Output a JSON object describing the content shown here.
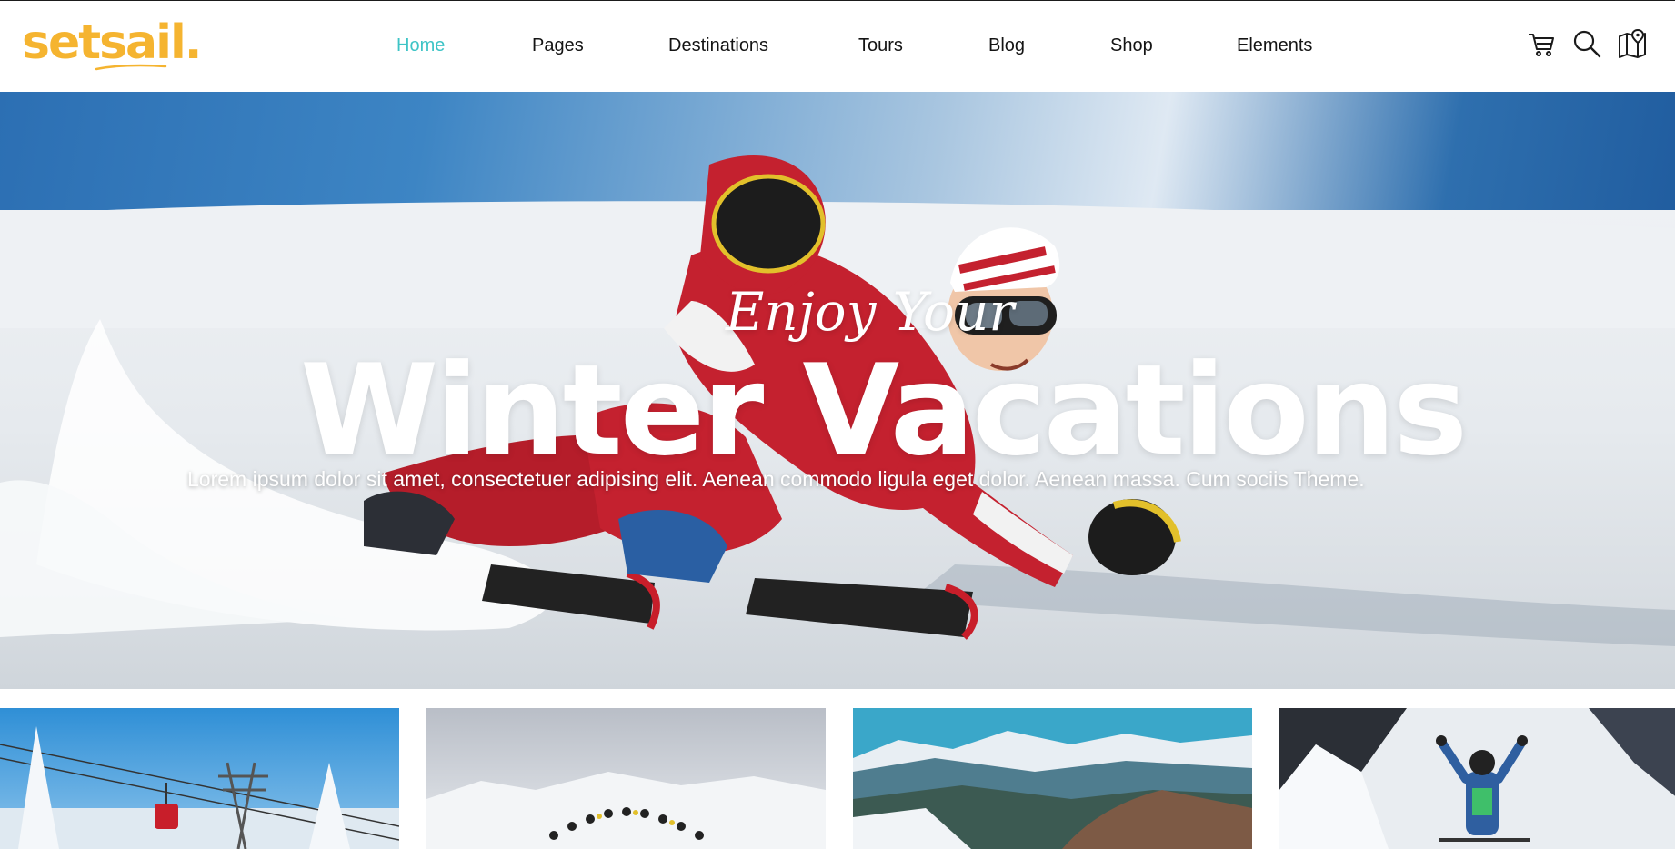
{
  "brand": {
    "logo_text": "setsail.",
    "color": "#f5b430"
  },
  "nav": {
    "active_color": "#3ec4c6",
    "items": [
      {
        "label": "Home",
        "active": true
      },
      {
        "label": "Pages",
        "active": false
      },
      {
        "label": "Destinations",
        "active": false
      },
      {
        "label": "Tours",
        "active": false
      },
      {
        "label": "Blog",
        "active": false
      },
      {
        "label": "Shop",
        "active": false
      },
      {
        "label": "Elements",
        "active": false
      }
    ],
    "icons": [
      "cart-icon",
      "search-icon",
      "map-icon"
    ]
  },
  "hero": {
    "script": "Enjoy Your",
    "headline": "Winter Vacations",
    "subtitle": "Lorem ipsum dolor sit amet, consectetuer adipising elit. Aenean commodo ligula eget dolor. Aenean massa. Cum sociis Theme."
  },
  "cards": [
    "ski-lift",
    "jump-sequence",
    "mountain-valley",
    "climber-summit"
  ]
}
